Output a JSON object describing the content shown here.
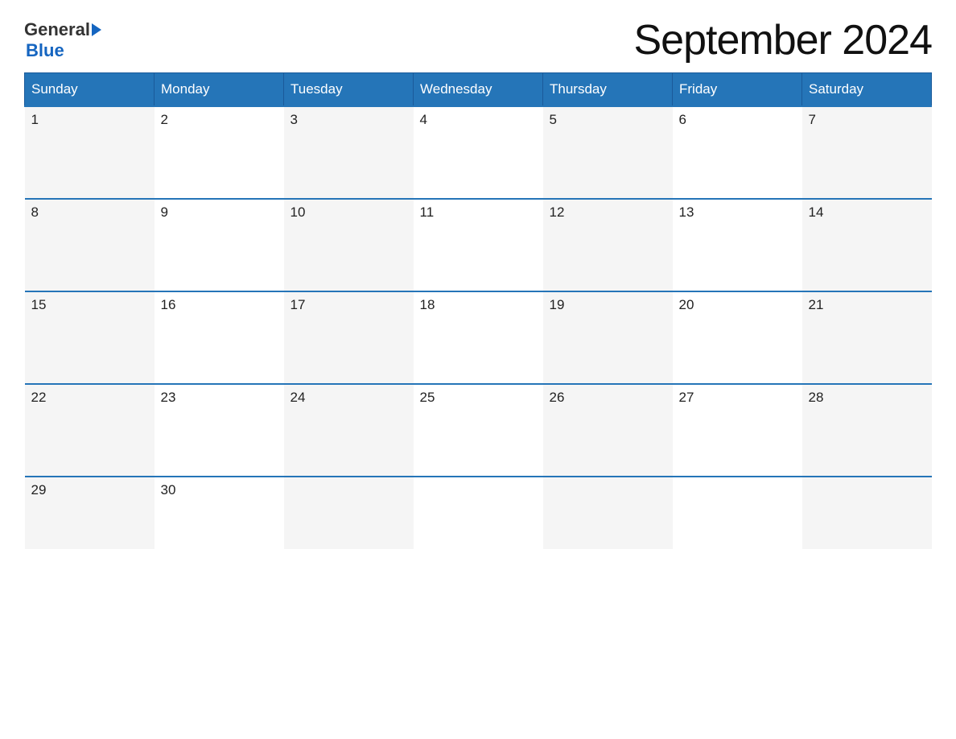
{
  "logo": {
    "general": "General",
    "blue": "Blue"
  },
  "title": "September 2024",
  "weekdays": [
    "Sunday",
    "Monday",
    "Tuesday",
    "Wednesday",
    "Thursday",
    "Friday",
    "Saturday"
  ],
  "weeks": [
    [
      {
        "day": "1",
        "empty": false
      },
      {
        "day": "2",
        "empty": false
      },
      {
        "day": "3",
        "empty": false
      },
      {
        "day": "4",
        "empty": false
      },
      {
        "day": "5",
        "empty": false
      },
      {
        "day": "6",
        "empty": false
      },
      {
        "day": "7",
        "empty": false
      }
    ],
    [
      {
        "day": "8",
        "empty": false
      },
      {
        "day": "9",
        "empty": false
      },
      {
        "day": "10",
        "empty": false
      },
      {
        "day": "11",
        "empty": false
      },
      {
        "day": "12",
        "empty": false
      },
      {
        "day": "13",
        "empty": false
      },
      {
        "day": "14",
        "empty": false
      }
    ],
    [
      {
        "day": "15",
        "empty": false
      },
      {
        "day": "16",
        "empty": false
      },
      {
        "day": "17",
        "empty": false
      },
      {
        "day": "18",
        "empty": false
      },
      {
        "day": "19",
        "empty": false
      },
      {
        "day": "20",
        "empty": false
      },
      {
        "day": "21",
        "empty": false
      }
    ],
    [
      {
        "day": "22",
        "empty": false
      },
      {
        "day": "23",
        "empty": false
      },
      {
        "day": "24",
        "empty": false
      },
      {
        "day": "25",
        "empty": false
      },
      {
        "day": "26",
        "empty": false
      },
      {
        "day": "27",
        "empty": false
      },
      {
        "day": "28",
        "empty": false
      }
    ],
    [
      {
        "day": "29",
        "empty": false
      },
      {
        "day": "30",
        "empty": false
      },
      {
        "day": "",
        "empty": true
      },
      {
        "day": "",
        "empty": true
      },
      {
        "day": "",
        "empty": true
      },
      {
        "day": "",
        "empty": true
      },
      {
        "day": "",
        "empty": true
      }
    ]
  ],
  "colors": {
    "header_bg": "#2575b8",
    "header_text": "#ffffff",
    "cell_odd_bg": "#f5f5f5",
    "cell_even_bg": "#ffffff",
    "border_color": "#2575b8",
    "logo_blue": "#1565c0",
    "title_color": "#111111"
  }
}
